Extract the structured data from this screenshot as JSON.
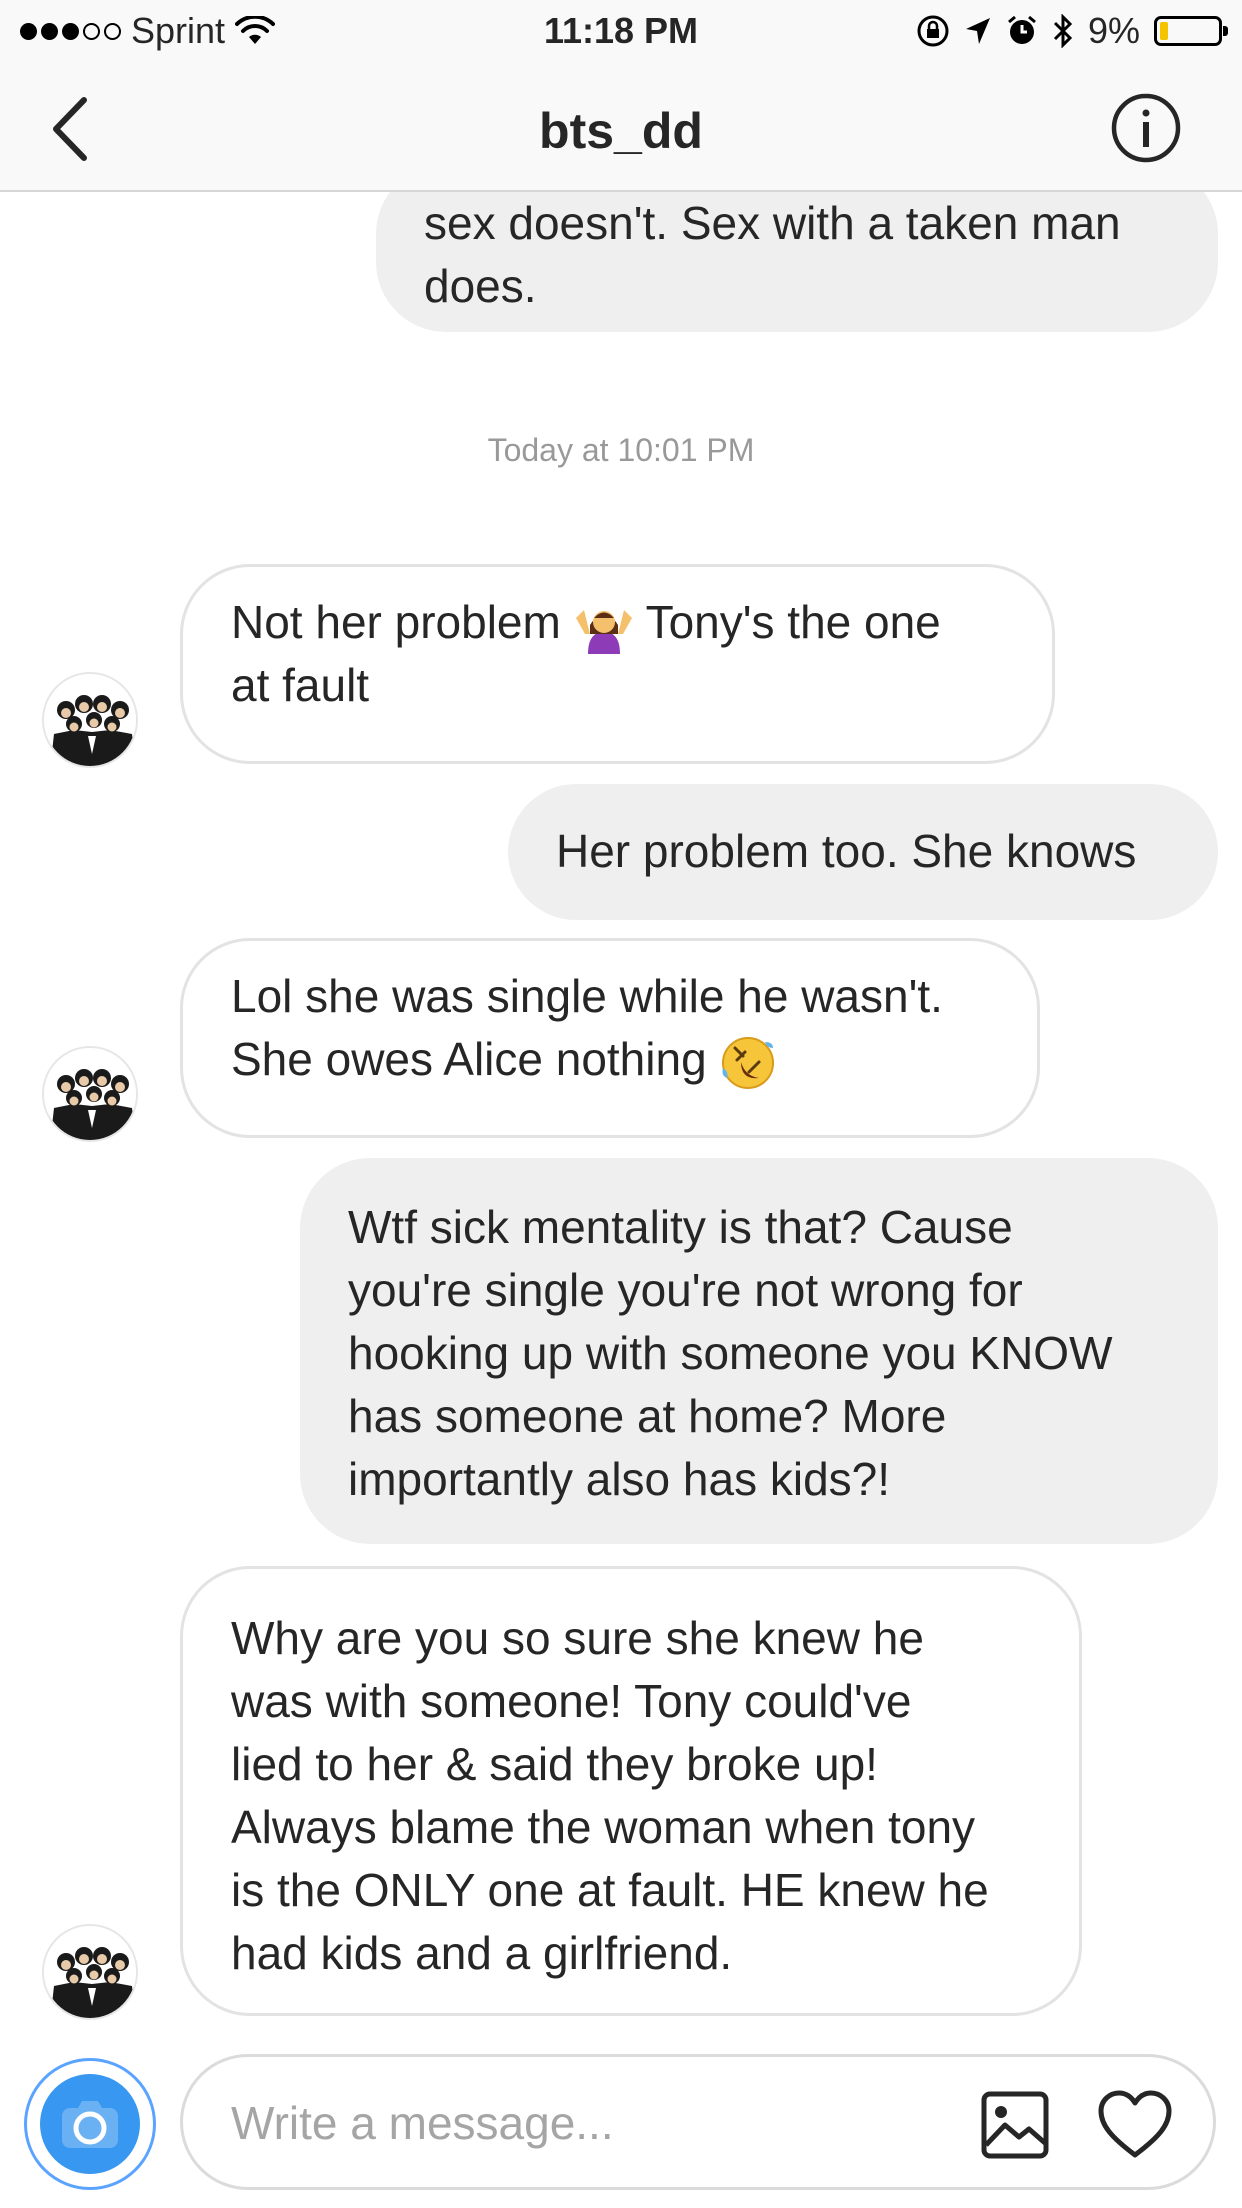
{
  "status_bar": {
    "carrier": "Sprint",
    "time": "11:18 PM",
    "battery": "9%",
    "battery_level": 0.09
  },
  "header": {
    "title": "bts_dd"
  },
  "thread": {
    "partial_message": {
      "lines": [
        "sex doesn't. Sex with a taken man",
        "does."
      ]
    },
    "timestamp": "Today at 10:01 PM",
    "messages": [
      {
        "from": "them",
        "lines": [
          "Not her problem",
          "Tony's the one",
          "at fault"
        ],
        "emoji": "woman-shrugging"
      },
      {
        "from": "me",
        "lines": [
          "Her problem too. She knows"
        ]
      },
      {
        "from": "them",
        "lines": [
          "Lol she was single while he wasn't.",
          "She owes Alice nothing"
        ],
        "emoji": "rolling-on-floor-laughing"
      },
      {
        "from": "me",
        "lines": [
          "Wtf sick mentality is that? Cause",
          "you're single you're not wrong for",
          "hooking up with someone you KNOW",
          "has someone at home? More",
          "importantly also has kids?!"
        ]
      },
      {
        "from": "them",
        "lines": [
          "Why are you so sure she knew he",
          "was with someone! Tony could've",
          "lied to her & said they broke up!",
          "Always blame the woman when tony",
          "is the ONLY one at fault. HE knew he",
          "had kids and a girlfriend."
        ]
      }
    ]
  },
  "composer": {
    "placeholder": "Write a message..."
  },
  "colors": {
    "accent": "#3897f0",
    "outgoing_bubble": "#efefef",
    "incoming_border": "#e3e3e3",
    "battery_fill": "#f5c400"
  }
}
